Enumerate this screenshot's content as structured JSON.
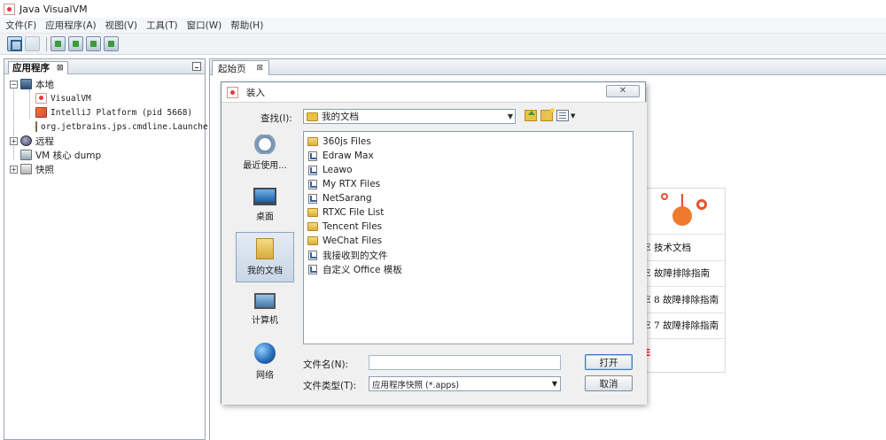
{
  "window": {
    "title": "Java VisualVM"
  },
  "menu": [
    "文件(F)",
    "应用程序(A)",
    "视图(V)",
    "工具(T)",
    "窗口(W)",
    "帮助(H)"
  ],
  "left_panel": {
    "tab": "应用程序",
    "tab_close": "⊠",
    "tree": {
      "local": "本地",
      "local_children": [
        "VisualVM",
        "IntelliJ Platform (pid 5668)",
        "org.jetbrains.jps.cmdline.Launcher"
      ],
      "remote": "远程",
      "core_dump": "VM 核心 dump",
      "snapshots": "快照",
      "expanded_symbol": "−",
      "collapsed_symbol": "+"
    }
  },
  "editor": {
    "tab": "起始页",
    "tab_close": "⊠",
    "start_page_items": [
      "E 技术文档",
      "E 故障排除指南",
      "E 8 故障排除指南",
      "E 7 故障排除指南",
      "E"
    ]
  },
  "dialog": {
    "title": "装入",
    "close_symbol": "✕",
    "look_in_label": "查找(I):",
    "look_in_value": "我的文档",
    "places": [
      {
        "label": "最近使用...",
        "icon": "recent-icon"
      },
      {
        "label": "桌面",
        "icon": "desktop-icon"
      },
      {
        "label": "我的文档",
        "icon": "documents-icon",
        "selected": true
      },
      {
        "label": "计算机",
        "icon": "computer-icon"
      },
      {
        "label": "网络",
        "icon": "network-icon"
      }
    ],
    "files": [
      {
        "name": "360js Files",
        "type": "folder"
      },
      {
        "name": "Edraw Max",
        "type": "link"
      },
      {
        "name": "Leawo",
        "type": "link"
      },
      {
        "name": "My RTX Files",
        "type": "link"
      },
      {
        "name": "NetSarang",
        "type": "link"
      },
      {
        "name": "RTXC File List",
        "type": "folder"
      },
      {
        "name": "Tencent Files",
        "type": "folder"
      },
      {
        "name": "WeChat Files",
        "type": "folder"
      },
      {
        "name": "我接收到的文件",
        "type": "link"
      },
      {
        "name": "自定义 Office 模板",
        "type": "link"
      }
    ],
    "file_name_label": "文件名(N):",
    "file_name_value": "",
    "file_type_label": "文件类型(T):",
    "file_type_value": "应用程序快照 (*.apps)",
    "open_button": "打开",
    "cancel_button": "取消"
  }
}
